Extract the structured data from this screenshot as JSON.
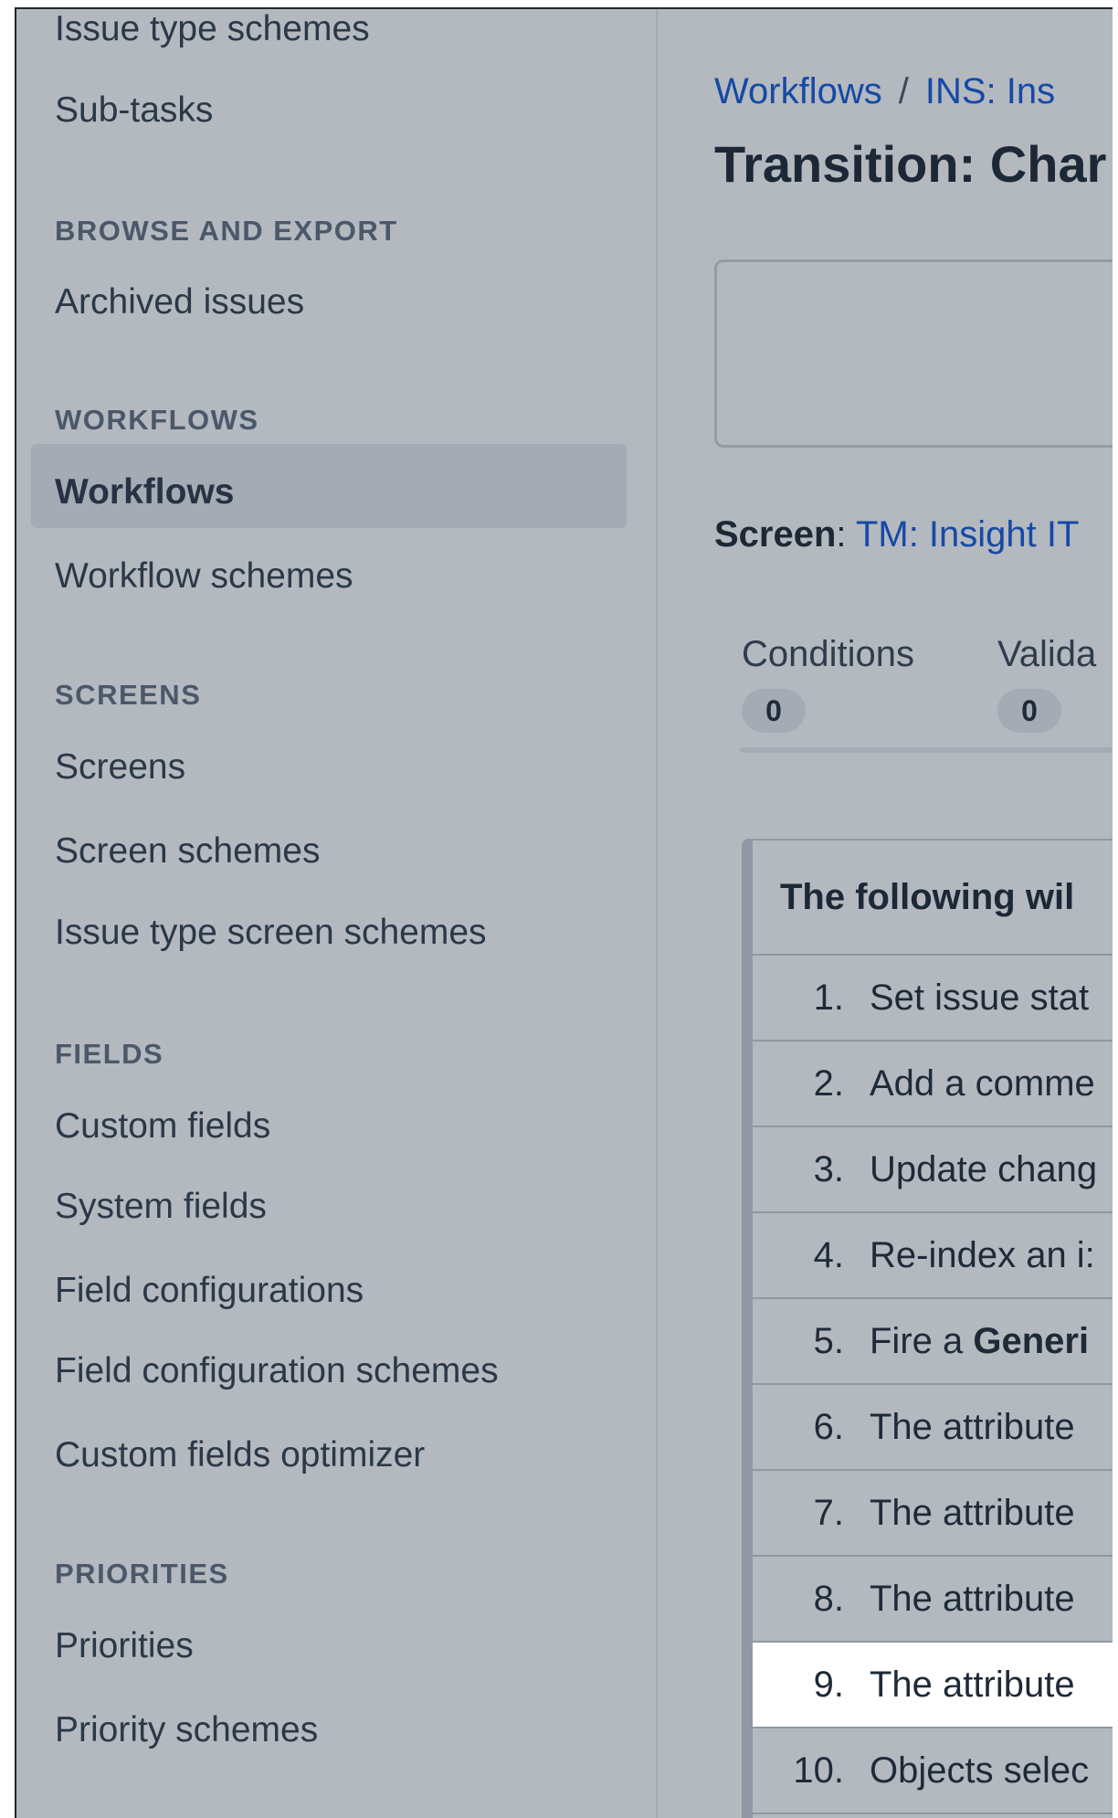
{
  "sidebar": {
    "items": {
      "issue_type_schemes": "Issue type schemes",
      "sub_tasks": "Sub-tasks",
      "archived_issues": "Archived issues",
      "workflows": "Workflows",
      "workflow_schemes": "Workflow schemes",
      "screens": "Screens",
      "screen_schemes": "Screen schemes",
      "issue_type_screen_schemes": "Issue type screen schemes",
      "custom_fields": "Custom fields",
      "system_fields": "System fields",
      "field_configurations": "Field configurations",
      "field_configuration_schemes": "Field configuration schemes",
      "custom_fields_optimizer": "Custom fields optimizer",
      "priorities": "Priorities",
      "priority_schemes": "Priority schemes"
    },
    "sections": {
      "browse_and_export": "BROWSE AND EXPORT",
      "workflows": "WORKFLOWS",
      "screens": "SCREENS",
      "fields": "FIELDS",
      "priorities": "PRIORITIES"
    },
    "active_item": "Workflows"
  },
  "main": {
    "breadcrumb": {
      "link1": "Workflows",
      "separator": "/",
      "link2": "INS: Ins"
    },
    "title": "Transition: Char",
    "screen": {
      "label": "Screen",
      "colon": ":",
      "value": "TM: Insight IT"
    },
    "tabs": [
      {
        "label": "Conditions",
        "count": "0"
      },
      {
        "label": "Valida",
        "count": "0"
      }
    ],
    "post_functions": {
      "header": "The following wil",
      "rows": [
        {
          "num": "1.",
          "text": "Set issue stat"
        },
        {
          "num": "2.",
          "text": "Add a comme"
        },
        {
          "num": "3.",
          "text": "Update chang"
        },
        {
          "num": "4.",
          "text": "Re-index an i:"
        },
        {
          "num": "5.",
          "text_prefix": "Fire a ",
          "text_bold": "Generi"
        },
        {
          "num": "6.",
          "text": "The attribute"
        },
        {
          "num": "7.",
          "text": "The attribute"
        },
        {
          "num": "8.",
          "text": "The attribute"
        },
        {
          "num": "9.",
          "text": "The attribute"
        },
        {
          "num": "10.",
          "text": "Objects selec"
        }
      ]
    }
  },
  "colors": {
    "sidebar_bg": "#b3b9bf",
    "active_item_bg": "#a4abb5",
    "link": "#1649a6",
    "highlight_row": "#ffffff"
  }
}
